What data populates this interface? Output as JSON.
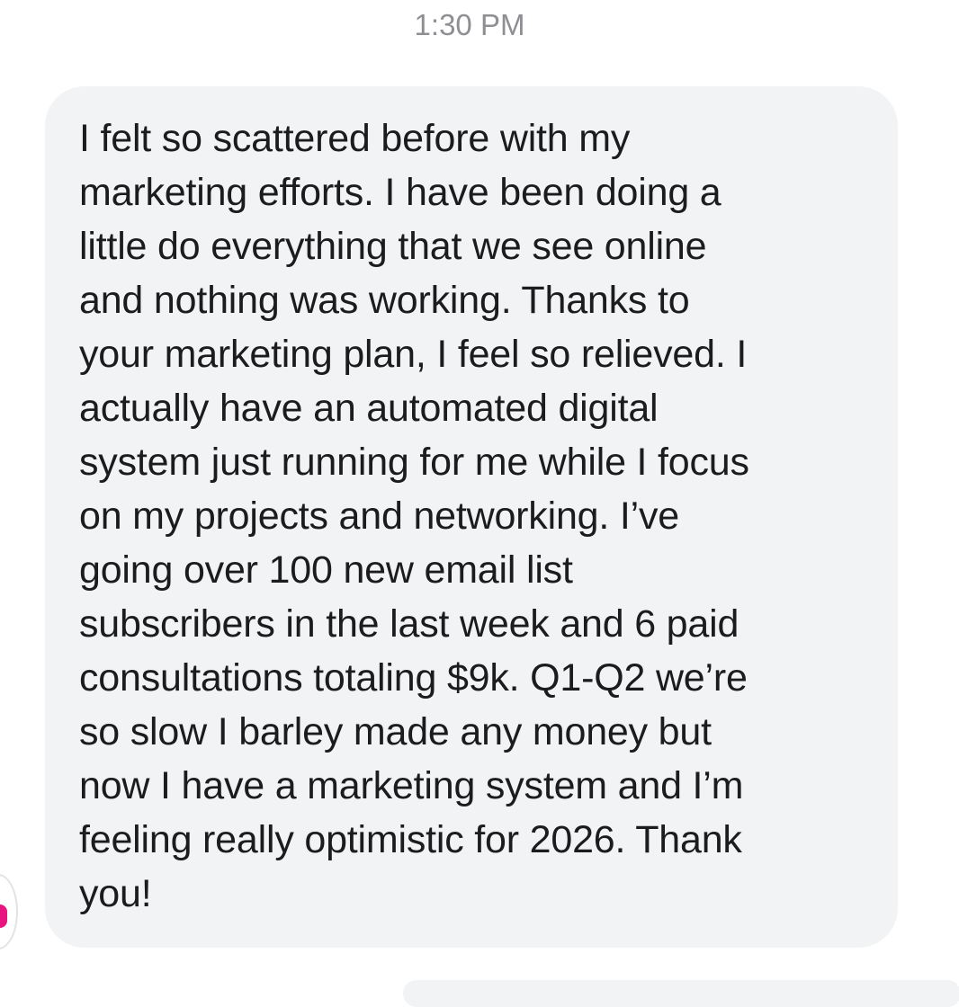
{
  "conversation": {
    "timestamp": "1:30 PM",
    "message": {
      "lines": [
        "I felt so scattered before with my",
        "marketing efforts. I have been doing a",
        "little do everything that we see online",
        "and nothing was working. Thanks to",
        "your marketing plan, I feel so relieved. I",
        "actually have an automated digital",
        "system just running for me while I focus",
        "on my projects and networking. I’ve",
        "going over 100 new email list",
        "subscribers in the last week and 6 paid",
        "consultations totaling $9k. Q1-Q2 we’re",
        "so slow I barley made any money but",
        "now I have a marketing system and I’m",
        "feeling really optimistic for 2026. Thank",
        "you!"
      ]
    }
  },
  "colors": {
    "bubble_background": "#f2f3f5",
    "message_text": "#1c1c1e",
    "timestamp_text": "#8e8e93",
    "avatar_accent": "#e8157f"
  },
  "icons": {
    "avatar": "sender-avatar"
  }
}
